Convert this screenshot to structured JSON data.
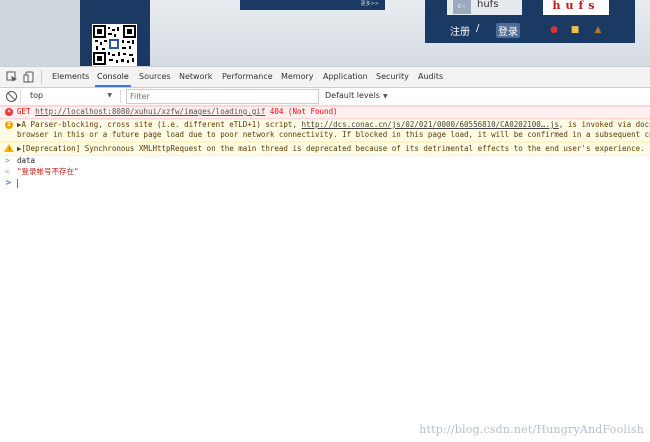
{
  "site": {
    "username": "hufs",
    "logo_text": "hufs",
    "avatar_text": "c~",
    "register_label": "注册",
    "separator": "/",
    "login_label": "登录",
    "more_label": "更多>>",
    "icons": [
      "person-icon",
      "image-icon",
      "poop-icon"
    ]
  },
  "devtools": {
    "tabs": [
      "Elements",
      "Console",
      "Sources",
      "Network",
      "Performance",
      "Memory",
      "Application",
      "Security",
      "Audits"
    ],
    "active_tab": "Console",
    "context": "top",
    "filter_placeholder": "Filter",
    "levels_label": "Default levels",
    "messages": {
      "error": {
        "method": "GET",
        "url": "http://localhost:8080/xuhui/xzfw/images/loading.gif",
        "status": "404 (Not Found)"
      },
      "warn1": {
        "count": "2",
        "text_a": "A Parser-blocking, cross site (i.e. different eTLD+1) script, ",
        "link": "http://dcs.conac.cn/js/02/021/0000/60556810/CA0202100….js",
        "text_b": ", is invoked via document.write.",
        "line2": "browser in this or a future page load due to poor network connectivity. If blocked in this page load, it will be confirmed in a subsequent console message."
      },
      "warn2": {
        "text": "[Deprecation] Synchronous XMLHttpRequest on the main thread is deprecated because of its detrimental effects to the end user's experience. For more help, check https://xhr.spec.whatwg.org/."
      },
      "input": "data",
      "output": "\"登录帐号不存在\""
    }
  },
  "watermark": "http://blog.csdn.net/HungryAndFoolish",
  "colors": {
    "site_navy": "#1b3a63",
    "error_red": "#f00",
    "warn_bg": "#fffbe5",
    "accent": "#3879d9"
  }
}
